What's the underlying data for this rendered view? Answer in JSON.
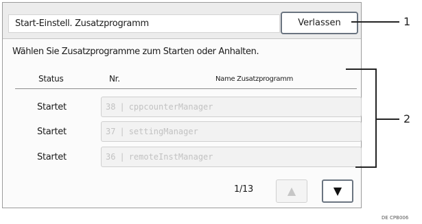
{
  "window": {
    "title": "Start-Einstell. Zusatzprogramm",
    "exit_label": "Verlassen"
  },
  "instruction": "Wählen Sie Zusatzprogramme zum Starten oder Anhalten.",
  "table": {
    "columns": {
      "status": "Status",
      "nr": "Nr.",
      "name": "Name Zusatzprogramm"
    },
    "rows": [
      {
        "status": "Startet",
        "nr": "38",
        "name": "cppcounterManager"
      },
      {
        "status": "Startet",
        "nr": "37",
        "name": "settingManager"
      },
      {
        "status": "Startet",
        "nr": "36",
        "name": "remoteInstManager"
      }
    ]
  },
  "pagination": {
    "indicator": "1/13",
    "up_icon": "▲",
    "down_icon": "▼"
  },
  "callouts": {
    "one": "1",
    "two": "2"
  },
  "figure_code": "DE CPB006"
}
